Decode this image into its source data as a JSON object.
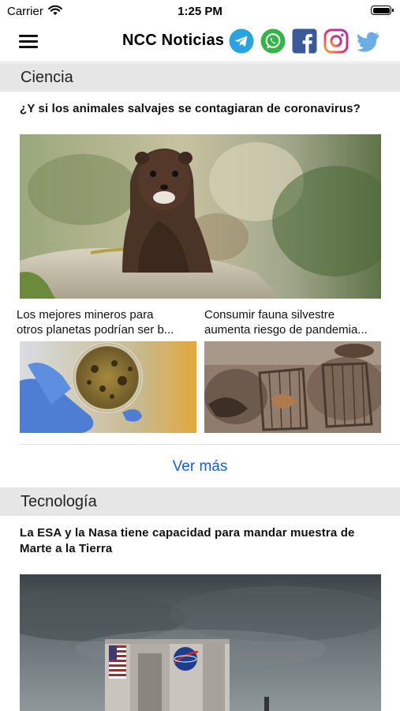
{
  "status_bar": {
    "carrier": "Carrier",
    "time": "1:25 PM"
  },
  "header": {
    "title": "NCC Noticias",
    "social": [
      "telegram-icon",
      "whatsapp-icon",
      "facebook-icon",
      "instagram-icon",
      "twitter-icon"
    ]
  },
  "sections": [
    {
      "title": "Ciencia",
      "featured": {
        "headline": "¿Y si los animales salvajes se contagiaran de coronavirus?"
      },
      "cards": [
        {
          "line1": "Los mejores mineros para",
          "line2": "otros planetas podrían ser b..."
        },
        {
          "line1": "Consumir fauna silvestre",
          "line2": "aumenta riesgo de pandemia..."
        }
      ],
      "more_label": "Ver más"
    },
    {
      "title": "Tecnología",
      "featured": {
        "line1": "La ESA y la Nasa tiene capacidad para mandar muestra de",
        "line2": "Marte a la Tierra"
      }
    }
  ],
  "colors": {
    "link": "#1a5fd0",
    "section_bg": "#e6e6e6",
    "telegram": "#2aa3df",
    "whatsapp": "#38b34a",
    "facebook": "#3b5998",
    "twitter": "#6aaee5"
  }
}
